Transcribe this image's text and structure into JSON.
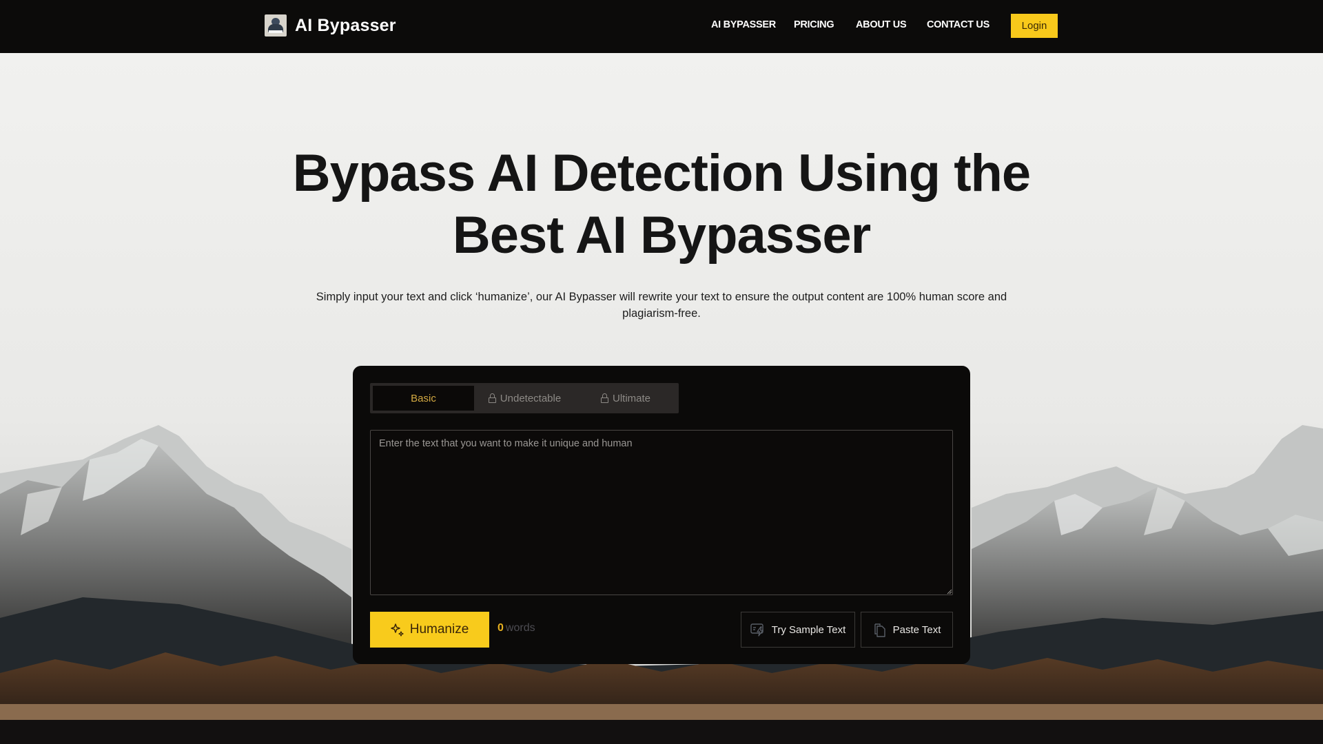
{
  "header": {
    "brand_name": "AI Bypasser",
    "logo_icon": "robot-reading-logo",
    "nav": [
      {
        "label": "AI BYPASSER"
      },
      {
        "label": "PRICING"
      },
      {
        "label": "ABOUT US"
      },
      {
        "label": "CONTACT US"
      }
    ],
    "login_label": "Login"
  },
  "hero": {
    "title_line1": "Bypass AI Detection Using the",
    "title_line2": "Best AI Bypasser",
    "subtitle": "Simply input your text and click ‘humanize’, our AI Bypasser will rewrite your text to ensure the output content are 100% human score and plagiarism-free."
  },
  "tool": {
    "tabs": [
      {
        "label": "Basic",
        "locked": false,
        "active": true
      },
      {
        "label": "Undetectable",
        "locked": true,
        "active": false
      },
      {
        "label": "Ultimate",
        "locked": true,
        "active": false
      }
    ],
    "input": {
      "value": "",
      "placeholder": "Enter the text that you want to make it unique and human"
    },
    "humanize_label": "Humanize",
    "word_count": "0",
    "word_label": "words",
    "sample_label": "Try Sample Text",
    "paste_label": "Paste Text"
  },
  "colors": {
    "accent": "#F8CB1C",
    "header_bg": "#0C0B0A",
    "card_bg": "#0B0A09",
    "active_tab_text": "#D3A942"
  }
}
